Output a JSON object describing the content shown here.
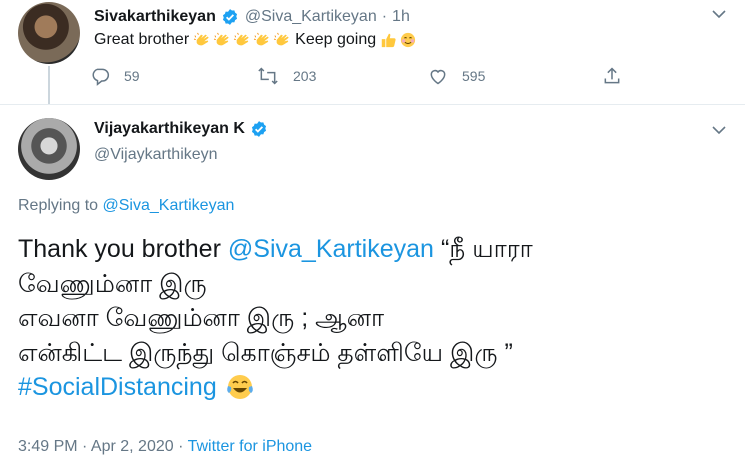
{
  "tweet": {
    "author_name": "Sivakarthikeyan",
    "author_handle": "@Siva_Kartikeyan",
    "dot": "·",
    "time": "1h",
    "text_before": "Great brother",
    "text_after": "Keep going",
    "reply_count": "59",
    "retweet_count": "203",
    "like_count": "595"
  },
  "reply": {
    "author_name": "Vijayakarthikeyan K",
    "author_handle": "@Vijaykarthikeyn",
    "replying_prefix": "Replying to",
    "replying_to": "@Siva_Kartikeyan",
    "line1_text": "Thank you brother",
    "line1_mention": "@Siva_Kartikeyan",
    "line1_quote": "“நீ யாரா",
    "line2": "வேணும்னா இரு",
    "line3": "எவனா வேணும்னா இரு ; ஆனா",
    "line4": "என்கிட்ட இருந்து கொஞ்சம் தள்ளியே இரு ”",
    "hashtag": "#SocialDistancing",
    "footer_time": "3:49 PM · Apr 2, 2020 ·",
    "footer_source": "Twitter for iPhone"
  },
  "colors": {
    "link": "#1b95e0",
    "muted": "#657786",
    "verified": "#1da1f2",
    "divider": "#e6ecf0"
  },
  "icons": [
    "verified-icon",
    "clap-emoji",
    "thumbs-up-emoji",
    "smiling-emoji",
    "tears-of-joy-emoji",
    "chevron-down-icon",
    "reply-icon",
    "retweet-icon",
    "like-icon",
    "share-icon"
  ]
}
